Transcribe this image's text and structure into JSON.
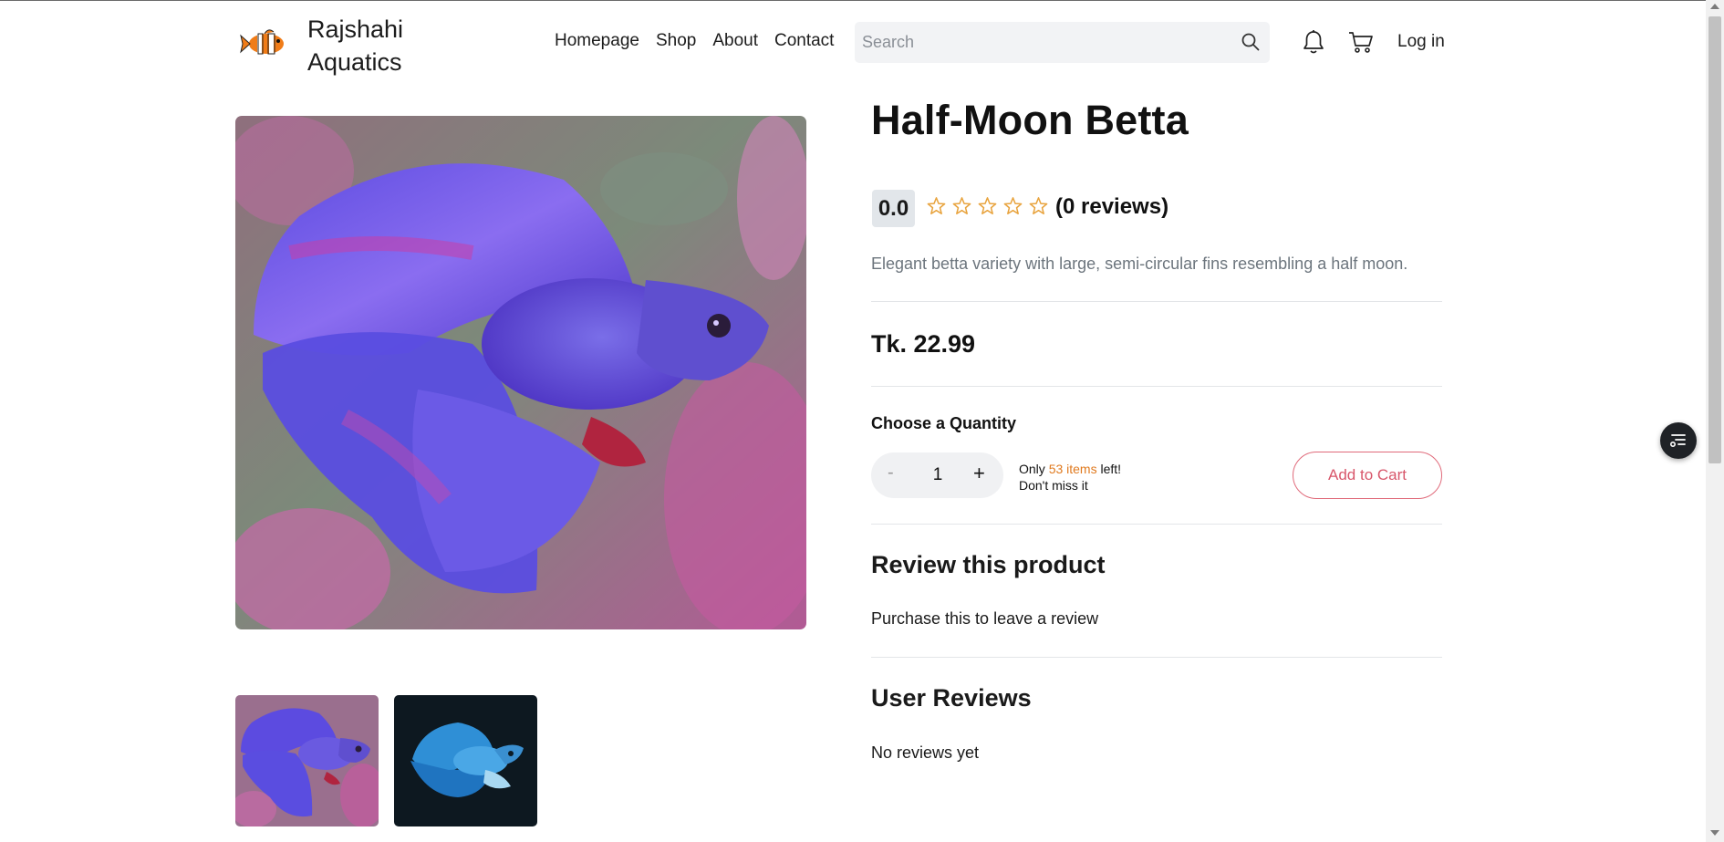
{
  "header": {
    "brand": "Rajshahi Aquatics",
    "brand_line1": "Rajshahi",
    "brand_line2": "Aquatics",
    "nav": [
      "Homepage",
      "Shop",
      "About",
      "Contact"
    ],
    "search_placeholder": "Search",
    "login": "Log in",
    "icons": {
      "logo": "clownfish-logo-icon",
      "search": "search-icon",
      "bell": "bell-icon",
      "cart": "cart-icon"
    }
  },
  "product": {
    "title": "Half-Moon Betta",
    "rating": "0.0",
    "stars_filled": 0,
    "stars_total": 5,
    "reviews_label": "(0 reviews)",
    "description": "Elegant betta variety with large, semi-circular fins resembling a half moon.",
    "price": "Tk. 22.99",
    "quantity_label": "Choose a Quantity",
    "quantity": "1",
    "minus": "-",
    "plus": "+",
    "stock_only": "Only",
    "stock_items": "53 items",
    "stock_left": "left!",
    "stock_line2": "Don't miss it",
    "add_to_cart": "Add to Cart",
    "thumbnails": [
      "purple-halfmoon-betta",
      "blue-halfmoon-betta"
    ]
  },
  "reviews": {
    "review_title": "Review this product",
    "review_note": "Purchase this to leave a review",
    "user_reviews_title": "User Reviews",
    "no_reviews": "No reviews yet"
  },
  "colors": {
    "accent": "#d8576b",
    "stock_highlight": "#e07a1f",
    "star": "#e8a33d",
    "badge_bg": "#e2e6ea"
  }
}
